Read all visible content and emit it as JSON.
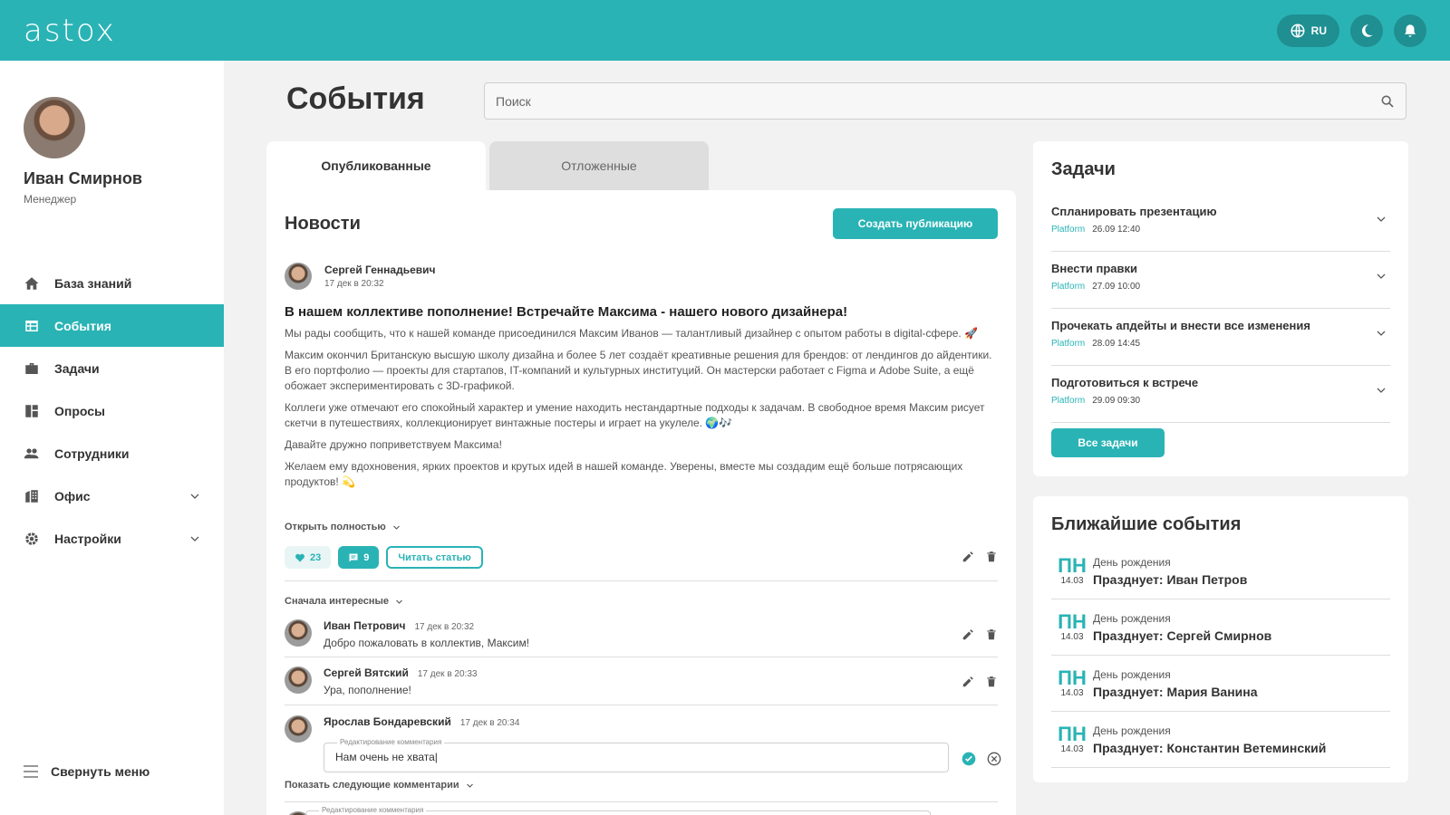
{
  "app": {
    "logo": "astox",
    "lang": "RU",
    "accent": "#2ab3b5"
  },
  "user": {
    "name": "Иван Смирнов",
    "role": "Менеджер"
  },
  "nav": [
    {
      "label": "База знаний",
      "icon": "home-icon"
    },
    {
      "label": "События",
      "icon": "calendar-list-icon"
    },
    {
      "label": "Задачи",
      "icon": "briefcase-icon"
    },
    {
      "label": "Опросы",
      "icon": "dashboard-icon"
    },
    {
      "label": "Сотрудники",
      "icon": "people-icon"
    },
    {
      "label": "Офис",
      "icon": "building-icon"
    },
    {
      "label": "Настройки",
      "icon": "gear-icon"
    }
  ],
  "collapse_label": "Свернуть меню",
  "page": {
    "title": "События",
    "search_placeholder": "Поиск"
  },
  "tabs": {
    "published": "Опубликованные",
    "deferred": "Отложенные"
  },
  "news": {
    "title": "Новости",
    "create_label": "Создать публикацию",
    "post": {
      "author": "Сергей Геннадьевич",
      "date": "17 дек в 20:32",
      "headline": "В нашем коллективе пополнение! Встречайте Максима - нашего нового дизайнера!",
      "paragraphs": [
        "Мы рады сообщить, что к нашей команде присоединился Максим Иванов — талантливый дизайнер с опытом работы в digital-сфере. 🚀",
        "Максим окончил Британскую высшую школу дизайна и более 5 лет создаёт креативные решения для брендов: от лендингов до айдентики. В его портфолио — проекты для стартапов, IT-компаний и культурных институций. Он мастерски работает с Figma и Adobe Suite, а ещё обожает экспериментировать с 3D-графикой.",
        "Коллеги уже отмечают его спокойный характер и умение находить нестандартные подходы к задачам. В свободное время Максим рисует скетчи в путешествиях, коллекционирует винтажные постеры и играет на укулеле. 🌍🎶",
        "Давайте дружно поприветствуем Максима!",
        "Желаем ему вдохновения, ярких проектов и крутых идей в нашей команде. Уверены, вместе мы создадим ещё больше потрясающих продуктов! 💫"
      ],
      "open_full": "Открыть полностью",
      "likes": "23",
      "comments": "9",
      "read_label": "Читать статью"
    },
    "sort_label": "Сначала интересные",
    "comments_list": [
      {
        "name": "Иван Петрович",
        "date": "17 дек в 20:32",
        "text": "Добро пожаловать в коллектив, Максим!"
      },
      {
        "name": "Сергей Вятский",
        "date": "17 дек в 20:33",
        "text": "Ура, пополнение!"
      },
      {
        "name": "Ярослав Бондаревский",
        "date": "17 дек в 20:34",
        "edit_label": "Редактирование комментария",
        "edit_value": "Нам очень не хвата|"
      }
    ],
    "show_next": "Показать следующие комментарии",
    "edit_label_2": "Редактирование комментария"
  },
  "tasks": {
    "title": "Задачи",
    "items": [
      {
        "name": "Спланировать презентацию",
        "platform": "Platform",
        "date": "26.09",
        "time": "12:40"
      },
      {
        "name": "Внести правки",
        "platform": "Platform",
        "date": "27.09",
        "time": "10:00"
      },
      {
        "name": "Прочекать апдейты и внести все изменения",
        "platform": "Platform",
        "date": "28.09",
        "time": "14:45"
      },
      {
        "name": "Подготовиться к встрече",
        "platform": "Platform",
        "date": "29.09",
        "time": "09:30"
      }
    ],
    "all_label": "Все задачи"
  },
  "events": {
    "title": "Ближайшие события",
    "items": [
      {
        "day": "ПН",
        "date": "14.03",
        "type": "День рождения",
        "who": "Празднует: Иван Петров"
      },
      {
        "day": "ПН",
        "date": "14.03",
        "type": "День рождения",
        "who": "Празднует: Сергей Смирнов"
      },
      {
        "day": "ПН",
        "date": "14.03",
        "type": "День рождения",
        "who": "Празднует: Мария Ванина"
      },
      {
        "day": "ПН",
        "date": "14.03",
        "type": "День рождения",
        "who": "Празднует: Константин Ветеминский"
      }
    ]
  }
}
